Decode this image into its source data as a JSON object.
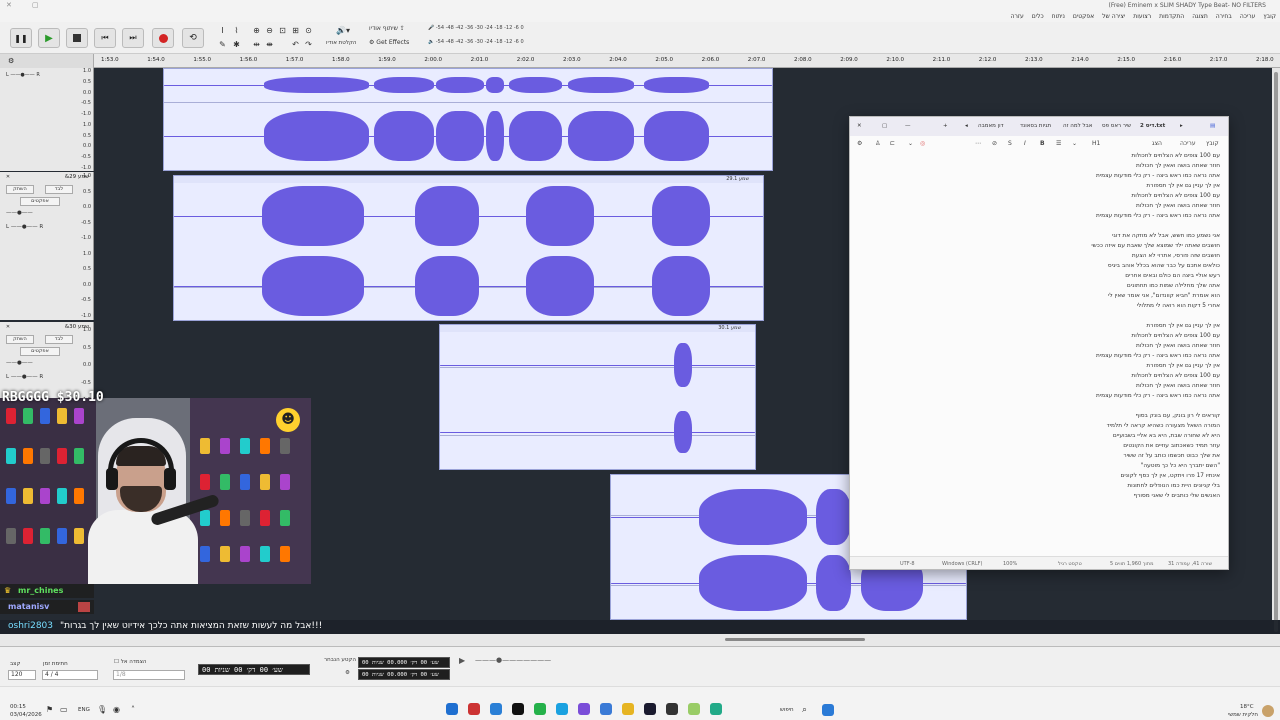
{
  "window": {
    "title": "(Free) Eminem x SLIM SHADY Type Beat- NO FILTERS"
  },
  "menu": [
    "קובץ",
    "עריכה",
    "בחירה",
    "תצוגה",
    "התקדמות",
    "רצועות",
    "יצירה של",
    "אפקטים",
    "ניתוח",
    "כלים",
    "עזרה"
  ],
  "toolbar": {
    "share_label": "שיתוף אודיו",
    "record_label": "הקלטת אודיו",
    "effects_label": "Get Effects",
    "meter_ticks_top": "-54 -48 -42 -36 -30 -24 -18 -12 -6 0",
    "meter_ticks_bottom": "-54 -48 -42 -36 -30 -24 -18 -12 -6 0"
  },
  "ruler": {
    "ticks": [
      "1:53.0",
      "1:54.0",
      "1:55.0",
      "1:56.0",
      "1:57.0",
      "1:58.0",
      "1:59.0",
      "2:00.0",
      "2:01.0",
      "2:02.0",
      "2:03.0",
      "2:04.0",
      "2:05.0",
      "2:06.0",
      "2:07.0",
      "2:08.0",
      "2:09.0",
      "2:10.0",
      "2:11.0",
      "2:12.0",
      "2:13.0",
      "2:14.0",
      "2:15.0",
      "2:16.0",
      "2:17.0",
      "2:18.0"
    ]
  },
  "tracks": [
    {
      "name": "",
      "scale": [
        "1.0",
        "0.5",
        "0.0",
        "-0.5",
        "-1.0",
        "1.0",
        "0.5",
        "0.0",
        "-0.5",
        "-1.0"
      ]
    },
    {
      "name": "שמע 29&",
      "mute": "השתק",
      "solo": "לבד",
      "effects": "אפקטים",
      "clip": "שמע 29.1",
      "scale": [
        "1.0",
        "0.5",
        "0.0",
        "-0.5",
        "-1.0",
        "1.0",
        "0.5",
        "0.0",
        "-0.5",
        "-1.0"
      ]
    },
    {
      "name": "שמע 30&",
      "mute": "השתק",
      "solo": "לבד",
      "effects": "אפקטים",
      "clip": "שמע 30.1",
      "scale": [
        "1.0",
        "0.5",
        "0.0",
        "-0.5",
        "-1.0"
      ]
    }
  ],
  "overlay": {
    "tag": "RBGGGG $30.10",
    "chat_users": [
      {
        "name": "mr_chines",
        "color": "#5fe05f"
      },
      {
        "name": "matanisv",
        "color": "#9fa8ff"
      }
    ],
    "chat_user": "oshri2803",
    "chat_message": "\"אבל מה לעשות שזאת המציאות אתה כלכך אידיוט שאין לך בגרות!!!"
  },
  "notepad": {
    "tabs": [
      "דיס 2.txt",
      "שיר ראס פס",
      "אבל למה זה",
      "תגיות בסאונד",
      "דון מאמבה"
    ],
    "menu": [
      "קובץ",
      "עריכה",
      "הצג"
    ],
    "heading": "H1",
    "lines": [
      "עם 100 צופים לא הצלחים לחכולות",
      "חוזר שאתה בושה ואאין לך חכולות",
      "אתה נראה כמו ראש ביצה - רק כלי מודעות עצמית",
      "אין לך עניין גם אין לך תספורת",
      "עם 100 צופים לא הצלחים לחכולות",
      "חוזר שאתה בושה ואאין לך חכולות",
      "אתה נראה כמו ראש ביצה - רק כלי מודעות עצמית",
      "",
      "אני נשמע כמו חשש, אבל לא מוזקה את דוגי",
      "חושבים שאתה ילד שמוצא שלך שאבת עם איזה ככשי",
      "חושבים שזה פורסי, אתרוי לא הצעת",
      "כולאים אתכם על כבר שהוא בכלל אוהב ביגיס",
      "רעש אוליי ביצה הם כולם ובאים אחרים",
      "אתה שלך מחלילה שמות כמו תחתונים",
      "הוא אומרת \"חביא קוונדום\", אני אומר שאין לי",
      "אחרי 5 דקות הוא רואה לי מתלולי",
      "",
      "אין לך עניין גם אין לך תספורת",
      "עם 100 צופים לא הצלחים לחכולות",
      "חוזר שאתה בושה ואאין לך חכולות",
      "אתה נראה כמו ראש ביצה - רק כלי מודעות עצמית",
      "אין לך עניין גם אין לך תספורת",
      "עם 100 צופים לא הצלחים לחכולות",
      "חוזר שאתה בושה ואאין לך חכולות",
      "אתה נראה כמו ראש ביצה - רק כלי מודעות עצמית",
      "",
      "קוראים לי רון בונק, עם בונק בסוף",
      "המורה השאל מצעורה כשהיא קראה לי תלמיד",
      "היא לא שחורה שבת, היא בא אליי בשבועיים",
      "עוזר תמיד כשאכתוב עוזיים את הקונטים",
      "את שלך כבוט תכשמו כותב על זה ששיר",
      "\"השם יתברך היא כל כך מוטעה\"",
      "אינתיו 17 פרו ויתקט, אין לך כסף לקונים",
      "בלי קניונים היית כמו הנופלים לחתונות",
      "האנשים שלי כותבים לי שאני מסורף"
    ],
    "status": {
      "position": "שורה 41, עמודה 31",
      "chars": "5 מתוך 1,960 תווים",
      "format": "טקסט רגיל",
      "zoom": "100%",
      "eol": "Windows (CRLF)",
      "encoding": "UTF-8"
    }
  },
  "selection": {
    "rate_label": "קצב",
    "rate_value": "120",
    "meter_label": "חתימת זמן",
    "meter_value": "4 / 4",
    "snap_label": "הצמדה אל",
    "snap_value": "1/8",
    "time_display": "00 שע׳ 00 דק׳ 00 שניות",
    "sel_label": "הקטע הנבחר",
    "sel_start": "00 שע׳ 00 דק׳ 00.000 שניות",
    "sel_end": "00 שע׳ 00 דק׳ 00.000 שניות"
  },
  "taskbar": {
    "time": "00:15",
    "date": "03/04/2026",
    "search": "חיפוש",
    "weather_temp": "18°C",
    "weather_text": "חלקית שמשי"
  }
}
